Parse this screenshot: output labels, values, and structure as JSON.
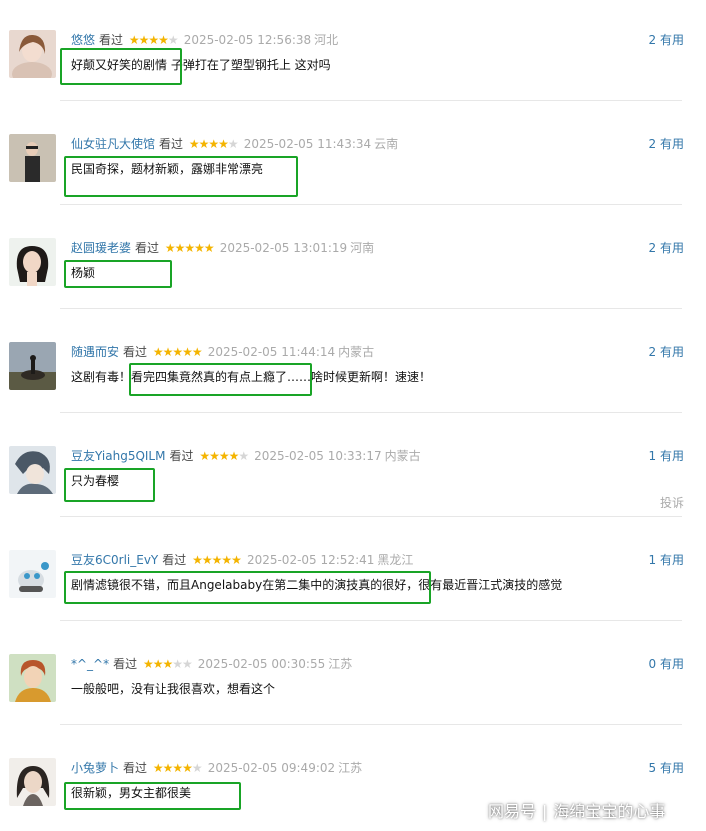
{
  "colors": {
    "link": "#3377aa",
    "star": "#f4b400",
    "star_empty": "#d6d6d6",
    "highlight_box": "#19a426",
    "meta_gray": "#aaaaaa"
  },
  "comments": [
    {
      "user": "悠悠",
      "status": "看过",
      "rating": 4,
      "time": "2025-02-05 12:56:38",
      "location": "河北",
      "votes": "2 有用",
      "content": "好颠又好笑的剧情 子弹打在了塑型钢托上 这对吗",
      "avatar_icon": "avatar-photo"
    },
    {
      "user": "仙女驻凡大使馆",
      "status": "看过",
      "rating": 4,
      "time": "2025-02-05 11:43:34",
      "location": "云南",
      "votes": "2 有用",
      "content": "民国奇探，题材新颖，露娜非常漂亮",
      "avatar_icon": "avatar-photo"
    },
    {
      "user": "赵圆瑗老婆",
      "status": "看过",
      "rating": 5,
      "time": "2025-02-05 13:01:19",
      "location": "河南",
      "votes": "2 有用",
      "content": "杨颖",
      "avatar_icon": "avatar-photo"
    },
    {
      "user": "随遇而安",
      "status": "看过",
      "rating": 5,
      "time": "2025-02-05 11:44:14",
      "location": "内蒙古",
      "votes": "2 有用",
      "content": "这剧有毒！看完四集竟然真的有点上瘾了……啥时候更新啊！速速！",
      "avatar_icon": "avatar-photo"
    },
    {
      "user": "豆友Yiahg5QILM",
      "status": "看过",
      "rating": 4,
      "time": "2025-02-05 10:33:17",
      "location": "内蒙古",
      "votes": "1 有用",
      "content": "只为春樱",
      "report": "投诉",
      "avatar_icon": "avatar-photo"
    },
    {
      "user": "豆友6C0rli_EvY",
      "status": "看过",
      "rating": 5,
      "time": "2025-02-05 12:52:41",
      "location": "黑龙江",
      "votes": "1 有用",
      "content": "剧情滤镜很不错，而且Angelababy在第二集中的演技真的很好，很有最近晋江式演技的感觉",
      "avatar_icon": "avatar-photo"
    },
    {
      "user": "*^_^*",
      "status": "看过",
      "rating": 3,
      "time": "2025-02-05 00:30:55",
      "location": "江苏",
      "votes": "0 有用",
      "content": "一般般吧，没有让我很喜欢，想看这个",
      "avatar_icon": "avatar-photo"
    },
    {
      "user": "小兔萝卜",
      "status": "看过",
      "rating": 4,
      "time": "2025-02-05 09:49:02",
      "location": "江苏",
      "votes": "5 有用",
      "content": "很新颖，男女主都很美",
      "avatar_icon": "avatar-photo"
    }
  ],
  "watermark": {
    "brand": "网易号",
    "author": "海绵宝宝的心事"
  }
}
